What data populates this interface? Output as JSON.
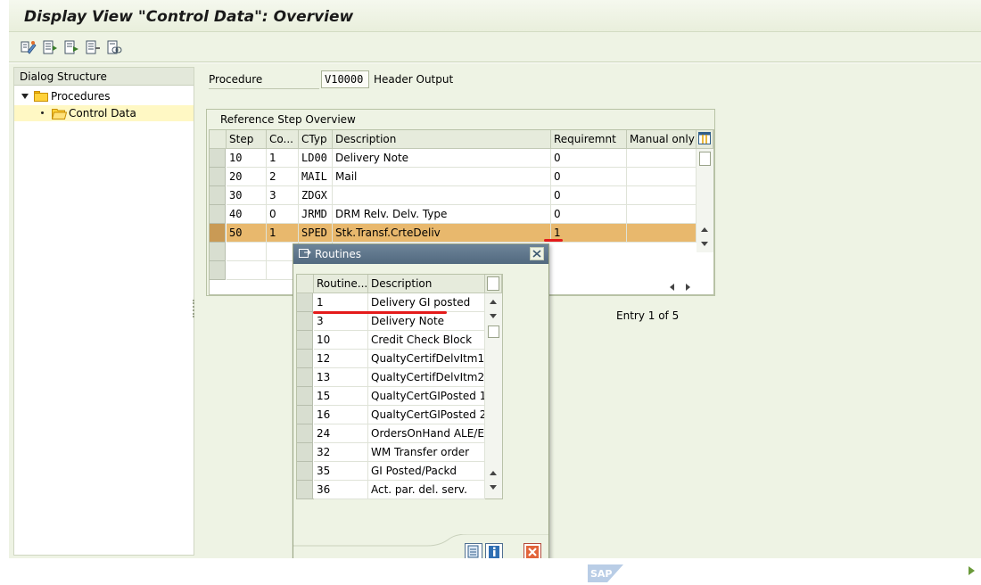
{
  "title": "Display View \"Control Data\": Overview",
  "toolbar": [
    "change-display-icon",
    "new-entries-icon",
    "copy-icon",
    "delete-icon",
    "select-all-icon"
  ],
  "tree": {
    "header": "Dialog Structure",
    "items": [
      {
        "label": "Procedures",
        "icon": "folder-icon",
        "level": 0,
        "selected": false
      },
      {
        "label": "Control Data",
        "icon": "folder-open-icon",
        "level": 1,
        "selected": true
      }
    ]
  },
  "procedure": {
    "label": "Procedure",
    "value": "V10000",
    "description": "Header Output"
  },
  "reference_steps": {
    "title": "Reference Step Overview",
    "columns": [
      "Step",
      "Co...",
      "CTyp",
      "Description",
      "Requiremnt",
      "Manual only"
    ],
    "rows": [
      [
        "10",
        "1",
        "LD00",
        "Delivery Note",
        "0",
        ""
      ],
      [
        "20",
        "2",
        "MAIL",
        "Mail",
        "0",
        ""
      ],
      [
        "30",
        "3",
        "ZDGX",
        "",
        "0",
        ""
      ],
      [
        "40",
        "0",
        "JRMD",
        "DRM Relv. Delv. Type",
        "0",
        ""
      ],
      [
        "50",
        "1",
        "SPED",
        "Stk.Transf.CrteDeliv",
        "1",
        ""
      ]
    ],
    "highlighted_row": 4,
    "entry_text": "Entry 1 of 5"
  },
  "routines_popup": {
    "title": "Routines",
    "columns": [
      "Routine...",
      "Description"
    ],
    "rows": [
      [
        "1",
        "Delivery GI posted"
      ],
      [
        "3",
        "Delivery Note"
      ],
      [
        "10",
        "Credit Check Block"
      ],
      [
        "12",
        "QualtyCertifDelvItm1"
      ],
      [
        "13",
        "QualtyCertifDelvItm2"
      ],
      [
        "15",
        "QualtyCertGIPosted 1"
      ],
      [
        "16",
        "QualtyCertGIPosted 2"
      ],
      [
        "24",
        "OrdersOnHand ALE/EDI"
      ],
      [
        "32",
        "WM Transfer order"
      ],
      [
        "35",
        "GI Posted/Packd"
      ],
      [
        "36",
        "Act. par. del. serv."
      ]
    ],
    "buttons": [
      "source-text-icon",
      "info-icon",
      "cancel-icon"
    ]
  },
  "colors": {
    "highlight": "#e8b86d",
    "annotation": "#e41b1b",
    "popup_title": "#5d7488",
    "background": "#eef3e4"
  },
  "sap_logo": "SAP"
}
